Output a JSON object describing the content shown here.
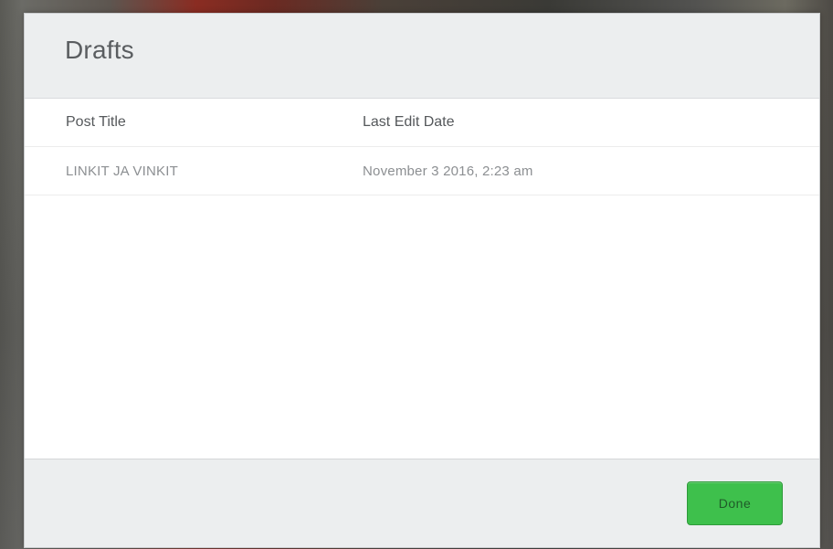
{
  "dialog": {
    "title": "Drafts",
    "columns": {
      "post_title": "Post Title",
      "last_edit_date": "Last Edit Date"
    },
    "rows": [
      {
        "post_title": "LINKIT JA VINKIT",
        "last_edit_date": "November 3 2016, 2:23 am"
      }
    ],
    "done_label": "Done"
  },
  "colors": {
    "accent_green": "#3ec04c",
    "header_bg": "#eceeef"
  }
}
